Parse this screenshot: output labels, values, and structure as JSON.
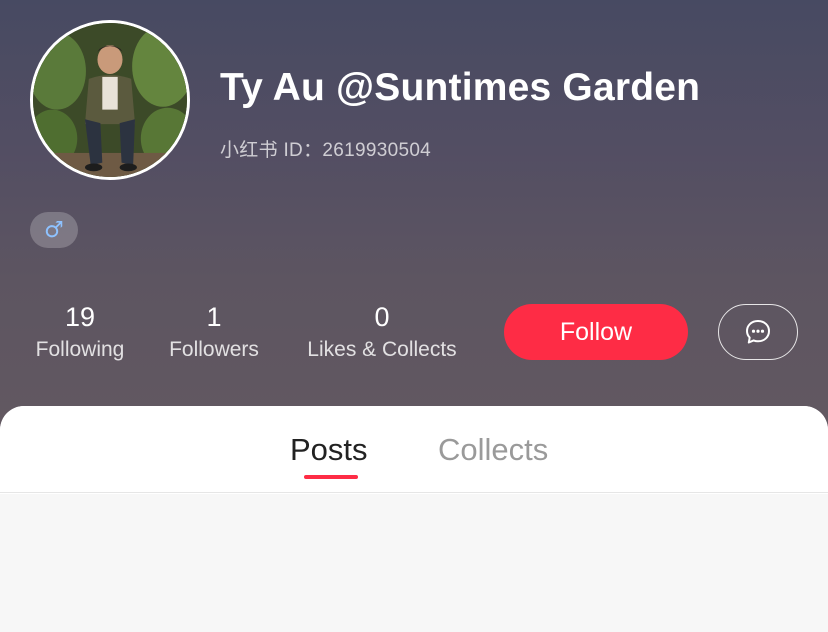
{
  "profile": {
    "name": "Ty Au @Suntimes Garden",
    "red_id": "小红书 ID：2619930504",
    "gender_symbol": "♂"
  },
  "stats": [
    {
      "value": "19",
      "label": "Following"
    },
    {
      "value": "1",
      "label": "Followers"
    },
    {
      "value": "0",
      "label": "Likes & Collects"
    }
  ],
  "actions": {
    "follow_label": "Follow",
    "message_icon": "chat-bubble-icon"
  },
  "tabs": [
    {
      "label": "Posts",
      "active": true
    },
    {
      "label": "Collects",
      "active": false
    }
  ],
  "colors": {
    "accent": "#fe2c45",
    "gender": "#8ec2ff"
  }
}
